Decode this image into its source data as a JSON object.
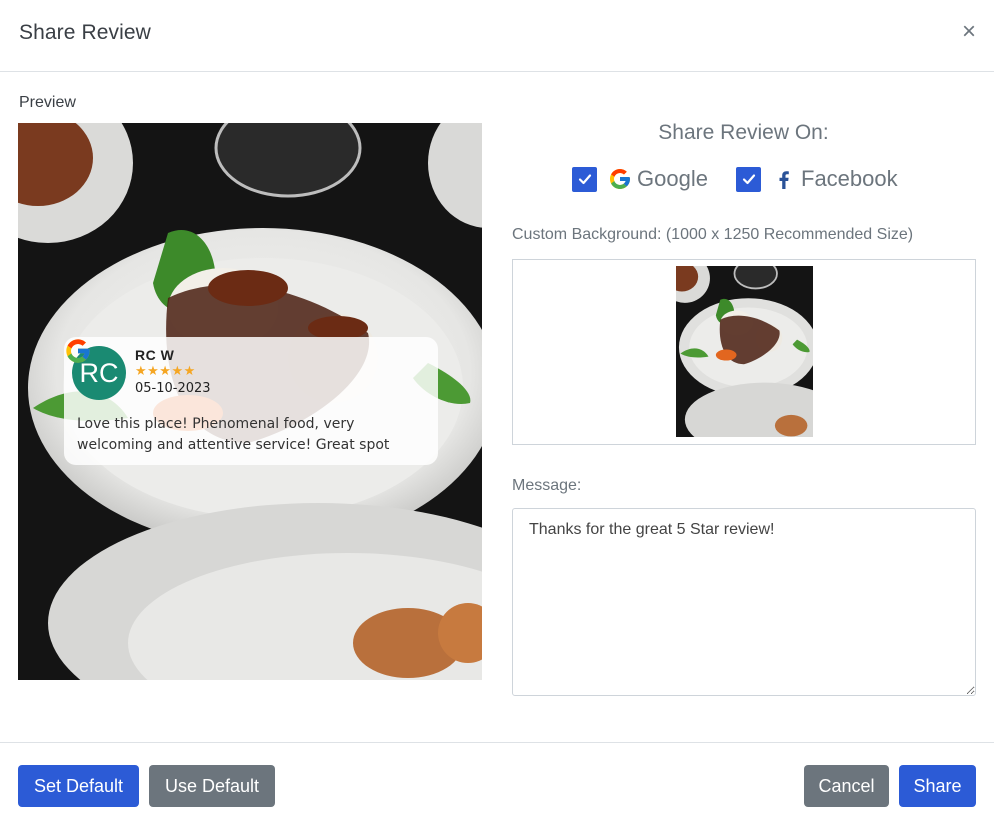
{
  "modal": {
    "title": "Share Review",
    "close_glyph": "×"
  },
  "preview": {
    "label": "Preview",
    "review": {
      "avatar_initials": "RC",
      "reviewer": "RC W",
      "stars_text": "★★★★★",
      "rating": 5,
      "date": "05-10-2023",
      "text": "Love this place! Phenomenal food, very welcoming and attentive service! Great spot",
      "source_icon": "google-icon"
    }
  },
  "share_on": {
    "title": "Share Review On:",
    "platforms": [
      {
        "label": "Google",
        "checked": true,
        "icon": "google-icon"
      },
      {
        "label": "Facebook",
        "checked": true,
        "icon": "facebook-icon"
      }
    ]
  },
  "custom_background": {
    "label": "Custom Background: (1000 x 1250 Recommended Size)"
  },
  "message": {
    "label": "Message:",
    "value": "Thanks for the great 5 Star review!"
  },
  "footer": {
    "set_default": "Set Default",
    "use_default": "Use Default",
    "cancel": "Cancel",
    "share": "Share"
  },
  "colors": {
    "primary": "#2c5bd6",
    "secondary": "#6c757d",
    "avatar": "#1a8a72",
    "stars": "#f5a623"
  }
}
